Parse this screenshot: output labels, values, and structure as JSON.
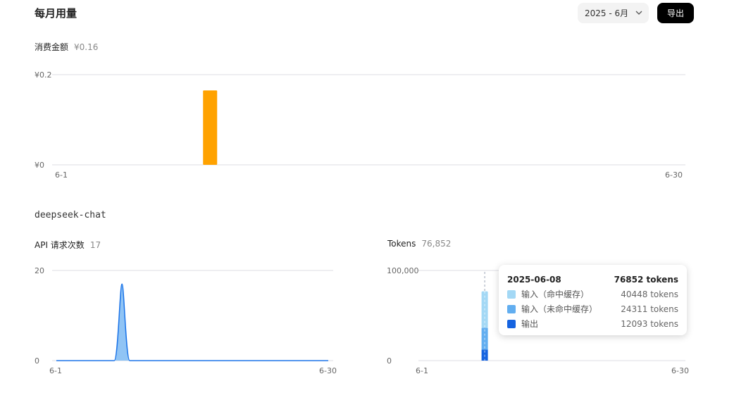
{
  "header": {
    "title": "每月用量",
    "month_label": "2025 - 6月",
    "export_label": "导出"
  },
  "cost": {
    "label": "消费金额",
    "value": "¥0.16",
    "chart_data": {
      "type": "bar",
      "x_start": "6-1",
      "x_end": "6-30",
      "y_ticks": [
        "¥0.2",
        "¥0"
      ],
      "ylim": [
        0,
        0.2
      ],
      "points": [
        {
          "day": 8,
          "value": 0.165
        }
      ],
      "color": "#ffa200"
    }
  },
  "model": {
    "name": "deepseek-chat"
  },
  "requests": {
    "label": "API 请求次数",
    "value": "17",
    "chart_data": {
      "type": "area",
      "x_start": "6-1",
      "x_end": "6-30",
      "y_ticks": [
        "20",
        "0"
      ],
      "ylim": [
        0,
        20
      ],
      "points": [
        {
          "day": 8,
          "value": 17
        }
      ],
      "color": "#1a73e8"
    }
  },
  "tokens": {
    "label": "Tokens",
    "value": "76,852",
    "chart_data": {
      "type": "bar",
      "stacked": true,
      "x_start": "6-1",
      "x_end": "6-30",
      "y_ticks": [
        "100,000",
        "0"
      ],
      "ylim": [
        0,
        100000
      ],
      "day": 8,
      "series": [
        {
          "name": "输出",
          "value": 12093,
          "color": "#1563e0"
        },
        {
          "name": "输入（未命中缓存）",
          "value": 24311,
          "color": "#62aef0"
        },
        {
          "name": "输入（命中缓存）",
          "value": 40448,
          "color": "#a3d8f5"
        }
      ]
    },
    "tooltip": {
      "date": "2025-06-08",
      "total": "76852 tokens",
      "rows": [
        {
          "name": "输入（命中缓存）",
          "value": "40448 tokens",
          "color": "#a3d8f5"
        },
        {
          "name": "输入（未命中缓存）",
          "value": "24311 tokens",
          "color": "#62aef0"
        },
        {
          "name": "输出",
          "value": "12093 tokens",
          "color": "#1563e0"
        }
      ]
    }
  }
}
